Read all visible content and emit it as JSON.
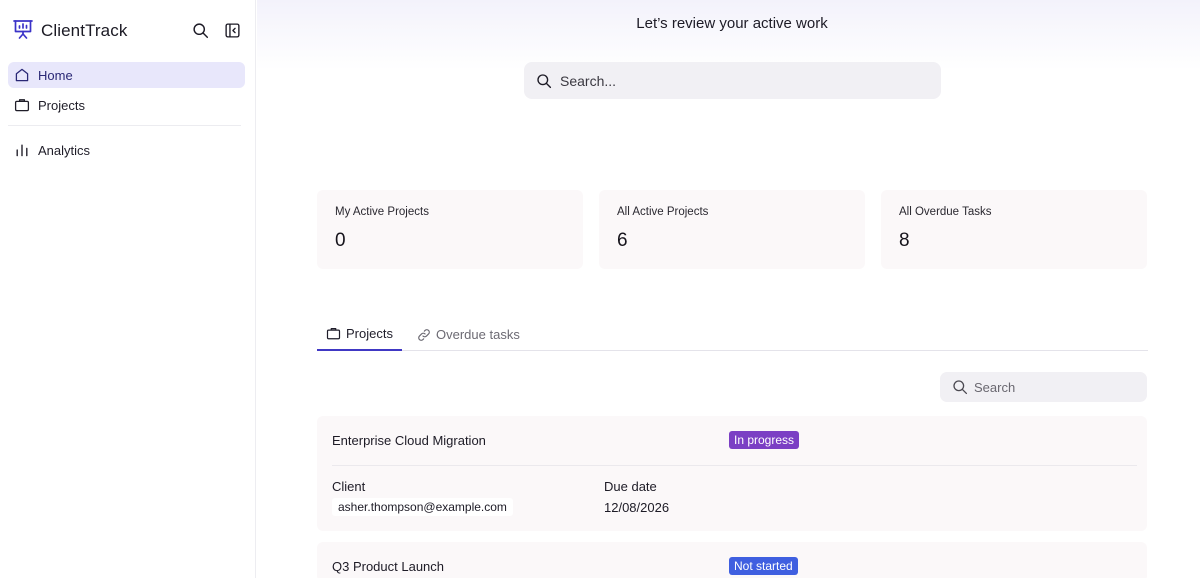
{
  "app": {
    "name": "ClientTrack"
  },
  "sidebar": {
    "items": [
      {
        "label": "Home",
        "icon": "home-icon",
        "active": true
      },
      {
        "label": "Projects",
        "icon": "briefcase-icon",
        "active": false
      },
      {
        "label": "Analytics",
        "icon": "bar-chart-icon",
        "active": false
      }
    ]
  },
  "header": {
    "title": "Let’s review your active work",
    "search_placeholder": "Search..."
  },
  "stats": [
    {
      "label": "My Active Projects",
      "value": "0"
    },
    {
      "label": "All Active Projects",
      "value": "6"
    },
    {
      "label": "All Overdue Tasks",
      "value": "8"
    }
  ],
  "tabs": [
    {
      "label": "Projects",
      "icon": "briefcase-icon",
      "active": true
    },
    {
      "label": "Overdue tasks",
      "icon": "link-icon",
      "active": false
    }
  ],
  "list": {
    "search_placeholder": "Search",
    "client_label": "Client",
    "due_label": "Due date",
    "projects": [
      {
        "name": "Enterprise Cloud Migration",
        "status": "In progress",
        "status_color": "#7b3fc4",
        "client": "asher.thompson@example.com",
        "due": "12/08/2026"
      },
      {
        "name": "Q3 Product Launch",
        "status": "Not started",
        "status_color": "#3f5fe0"
      }
    ]
  },
  "colors": {
    "accent": "#4038c4",
    "active_nav_bg": "#e8e7fb",
    "card_bg": "#fbf8f9"
  }
}
